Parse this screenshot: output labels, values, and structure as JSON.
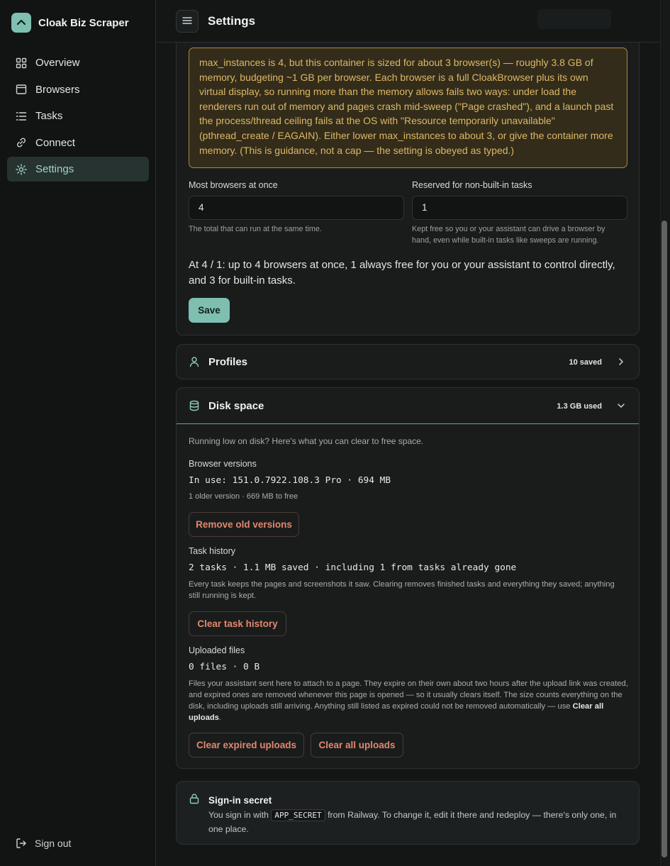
{
  "app": {
    "name": "Cloak Biz Scraper"
  },
  "sidebar": {
    "items": [
      {
        "label": "Overview",
        "icon": "grid-icon"
      },
      {
        "label": "Browsers",
        "icon": "window-icon"
      },
      {
        "label": "Tasks",
        "icon": "list-icon"
      },
      {
        "label": "Connect",
        "icon": "link-icon"
      },
      {
        "label": "Settings",
        "icon": "gear-icon",
        "active": true
      }
    ],
    "signout_label": "Sign out"
  },
  "header": {
    "title": "Settings"
  },
  "browsers_section": {
    "warning": "max_instances is 4, but this container is sized for about 3 browser(s) — roughly 3.8 GB of memory, budgeting ~1 GB per browser. Each browser is a full CloakBrowser plus its own virtual display, so running more than the memory allows fails two ways: under load the renderers run out of memory and pages crash mid-sweep (\"Page crashed\"), and a launch past the process/thread ceiling fails at the OS with \"Resource temporarily unavailable\" (pthread_create / EAGAIN). Either lower max_instances to about 3, or give the container more memory. (This is guidance, not a cap — the setting is obeyed as typed.)",
    "max_label": "Most browsers at once",
    "max_value": "4",
    "max_hint": "The total that can run at the same time.",
    "reserved_label": "Reserved for non-built-in tasks",
    "reserved_value": "1",
    "reserved_hint": "Kept free so you or your assistant can drive a browser by hand, even while built-in tasks like sweeps are running.",
    "summary": "At 4 / 1: up to 4 browsers at once, 1 always free for you or your assistant to control directly, and 3 for built-in tasks.",
    "save_label": "Save"
  },
  "profiles": {
    "title": "Profiles",
    "meta": "10 saved"
  },
  "disk": {
    "title": "Disk space",
    "meta": "1.3 GB used",
    "intro": "Running low on disk? Here's what you can clear to free space.",
    "browser_versions": {
      "label": "Browser versions",
      "in_use": "In use: 151.0.7922.108.3 Pro · 694 MB",
      "older": "1 older version · 669 MB to free",
      "button": "Remove old versions"
    },
    "task_history": {
      "label": "Task history",
      "summary": "2 tasks · 1.1 MB saved · including 1 from tasks already gone",
      "desc": "Every task keeps the pages and screenshots it saw. Clearing removes finished tasks and everything they saved; anything still running is kept.",
      "button": "Clear task history"
    },
    "uploads": {
      "label": "Uploaded files",
      "summary": "0 files · 0 B",
      "desc": "Files your assistant sent here to attach to a page. They expire on their own about two hours after the upload link was created, and expired ones are removed whenever this page is opened — so it usually clears itself. The size counts everything on the disk, including uploads still arriving. Anything still listed as expired could not be removed automatically — use ",
      "desc_bold": "Clear all uploads",
      "desc_end": ".",
      "button_expired": "Clear expired uploads",
      "button_all": "Clear all uploads"
    }
  },
  "secret": {
    "title": "Sign-in secret",
    "text_before": "You sign in with ",
    "code": "APP_SECRET",
    "text_after": " from Railway. To change it, edit it there and redeploy — there's only one, in one place."
  }
}
